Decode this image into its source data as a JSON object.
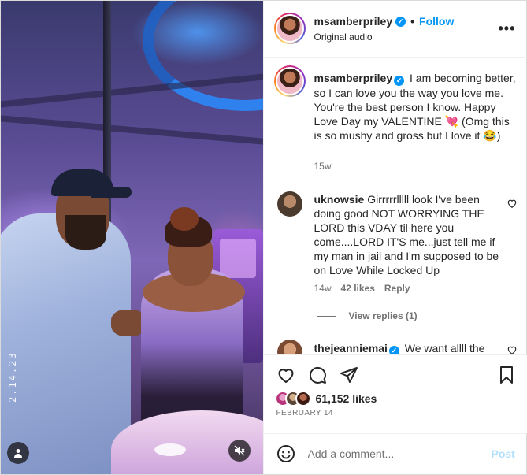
{
  "media": {
    "date_stamp": "2.14.23"
  },
  "header": {
    "username": "msamberpriley",
    "follow_label": "Follow",
    "audio_label": "Original audio",
    "more_label": "•••"
  },
  "caption": {
    "username": "msamberpriley",
    "text": "I am becoming better, so I can love you the way you love me. You're the best person I know. Happy Love Day my VALENTINE 💘 (Omg this is so mushy and gross but I love it 😂)",
    "time": "15w"
  },
  "comments": [
    {
      "username": "uknowsie",
      "text": "Girrrrrlllll look I've been doing good NOT WORRYING THE LORD this VDAY til here you come....LORD IT'S me...just tell me if my man in jail and I'm supposed to be on Love While Locked Up",
      "time": "14w",
      "likes": "42 likes",
      "reply_label": "Reply",
      "view_replies": "View replies (1)"
    },
    {
      "username": "thejeanniemai",
      "text": "We want allll the"
    }
  ],
  "actions": {
    "likes": "61,152 likes",
    "date": "FEBRUARY 14"
  },
  "add_comment": {
    "placeholder": "Add a comment...",
    "post_label": "Post"
  },
  "colors": {
    "accent": "#0095f6",
    "post_disabled": "#b2dffc",
    "muted_text": "#737373"
  }
}
